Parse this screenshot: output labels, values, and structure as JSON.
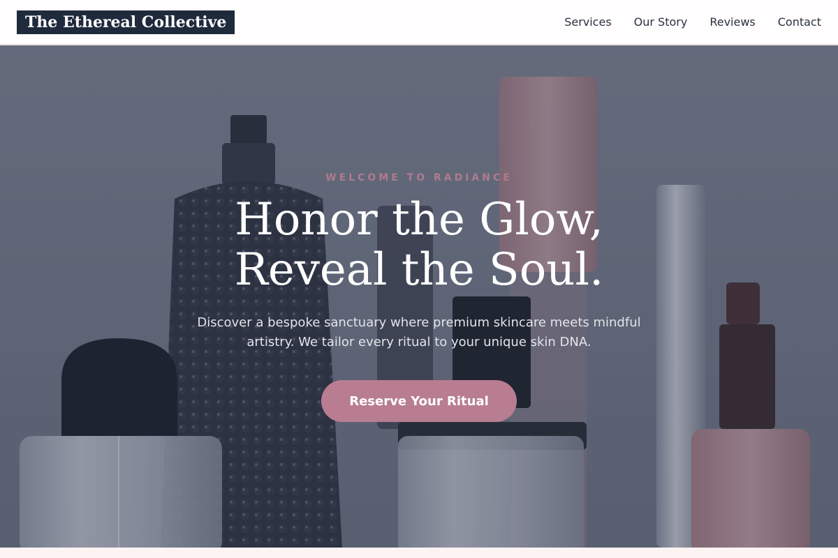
{
  "brand": {
    "name": "The Ethereal Collective"
  },
  "nav": {
    "items": [
      {
        "label": "Services"
      },
      {
        "label": "Our Story"
      },
      {
        "label": "Reviews"
      },
      {
        "label": "Contact"
      }
    ]
  },
  "hero": {
    "eyebrow": "WELCOME TO RADIANCE",
    "headline_line1": "Honor the Glow,",
    "headline_line2": "Reveal the Soul.",
    "description": "Discover a bespoke sanctuary where premium skincare meets mindful artistry. We tailor every ritual to your unique skin DNA.",
    "cta_label": "Reserve Your Ritual"
  },
  "colors": {
    "logo_background": "#1f2a3c",
    "accent": "#b87d91",
    "eyebrow": "#b07a8f",
    "page_background": "#fdf3f3"
  }
}
